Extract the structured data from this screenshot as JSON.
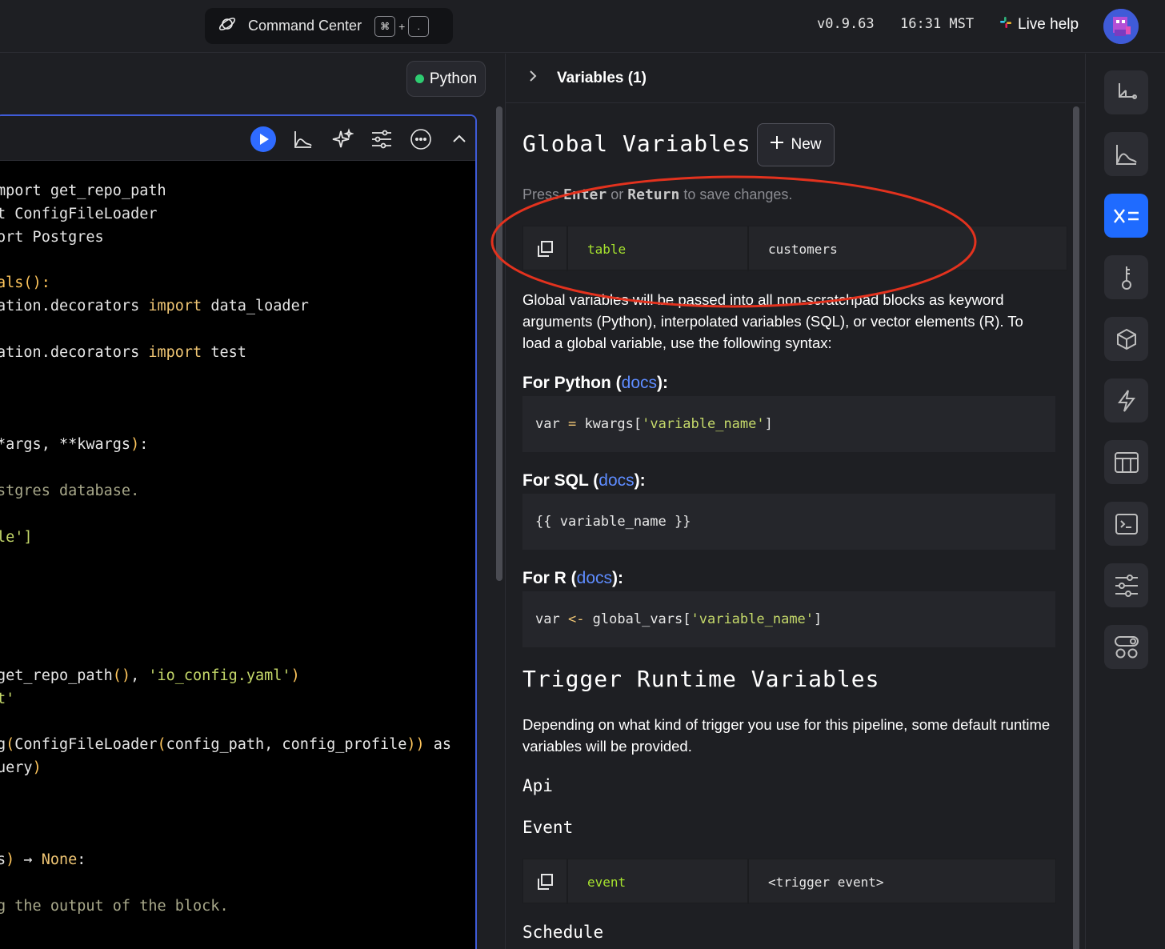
{
  "topbar": {
    "command_center": "Command Center",
    "kbd_key1": "⌘",
    "kbd_plus": "+",
    "kbd_key2": ".",
    "version": "v0.9.63",
    "time": "16:31 MST",
    "live_help": "Live help"
  },
  "editor": {
    "kernel_label": "Python",
    "code_lines": [
      [
        {
          "t": "mport get_repo_path",
          "c": "mix1"
        }
      ],
      [
        {
          "t": "t ConfigFileLoader",
          "c": "mix2"
        }
      ],
      [
        {
          "t": "ort Postgres",
          "c": "mix3"
        }
      ],
      [
        {
          "t": "",
          "c": ""
        }
      ],
      [
        {
          "t": "als():",
          "c": "mix4"
        }
      ],
      [
        {
          "t": "ation.decorators import data_loader",
          "c": "mix5"
        }
      ],
      [
        {
          "t": "",
          "c": ""
        }
      ],
      [
        {
          "t": "ation.decorators import test",
          "c": "mix6"
        }
      ],
      [
        {
          "t": "",
          "c": ""
        }
      ],
      [
        {
          "t": "",
          "c": ""
        }
      ],
      [
        {
          "t": "",
          "c": ""
        }
      ],
      [
        {
          "t": "*args, **kwargs):",
          "c": "mix7"
        }
      ],
      [
        {
          "t": "",
          "c": ""
        }
      ],
      [
        {
          "t": "stgres database.",
          "c": "cm"
        }
      ],
      [
        {
          "t": "",
          "c": ""
        }
      ],
      [
        {
          "t": "le']",
          "c": "mix8"
        }
      ]
    ],
    "code_text": [
      "mport get_repo_path",
      "t ConfigFileLoader",
      "ort Postgres",
      "",
      "als():",
      "ation.decorators import data_loader",
      "",
      "ation.decorators import test",
      "",
      "",
      "",
      "*args, **kwargs):",
      "",
      "stgres database.",
      "",
      "le']",
      "",
      "",
      "",
      "",
      "",
      "get_repo_path(), 'io_config.yaml')",
      "t'",
      "",
      "g(ConfigFileLoader(config_path, config_profile)) as",
      "uery)",
      "",
      "",
      "",
      "s) → None:",
      "",
      "g the output of the block."
    ]
  },
  "panel": {
    "header_title": "Variables (1)",
    "global_title": "Global Variables",
    "new_button": "New",
    "hint_press": "Press",
    "hint_enter": "Enter",
    "hint_or": "or",
    "hint_return": "Return",
    "hint_tail": "to save changes.",
    "global_var": {
      "name": "table",
      "value": "customers"
    },
    "global_desc": "Global variables will be passed into all non-scratchpad blocks as keyword arguments (Python), interpolated variables (SQL), or vector elements (R). To load a global variable, use the following syntax:",
    "python_label": "For Python (",
    "sql_label": "For SQL (",
    "r_label": "For R (",
    "docs": "docs",
    "label_close": "):",
    "python_code": {
      "a": "var ",
      "op": "=",
      "b": " kwargs[",
      "s": "'variable_name'",
      "c": "]"
    },
    "sql_code": "{{ variable_name }}",
    "r_code": {
      "a": "var ",
      "op": "<-",
      "b": " global_vars[",
      "s": "'variable_name'",
      "c": "]"
    },
    "trigger_title": "Trigger Runtime Variables",
    "trigger_desc": "Depending on what kind of trigger you use for this pipeline, some default runtime variables will be provided.",
    "trigger_api": "Api",
    "trigger_event": "Event",
    "event_var": {
      "name": "event",
      "value": "<trigger event>"
    },
    "trigger_schedule": "Schedule"
  },
  "colors": {
    "accent": "#1f6bff",
    "block_border": "#3f5bd8",
    "annotation": "#e3321e",
    "var_name": "#a6e22e",
    "docs_link": "#5e8cff"
  },
  "rail_icons": [
    "tree-icon",
    "chart-icon",
    "variables-icon",
    "secrets-icon",
    "cube-icon",
    "lightning-icon",
    "table-icon",
    "terminal-icon",
    "settings-icon",
    "toggles-icon"
  ]
}
